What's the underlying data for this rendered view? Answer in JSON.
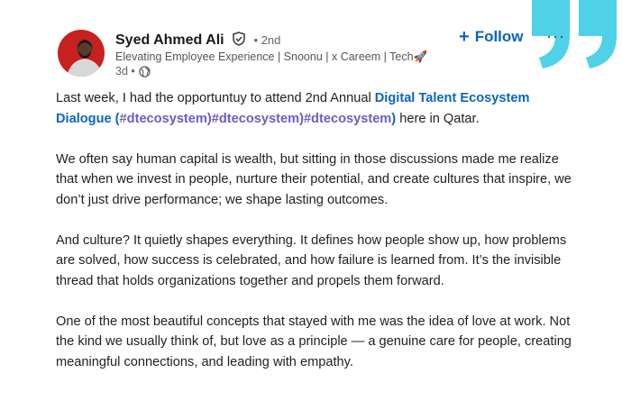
{
  "author": {
    "name": "Syed Ahmed Ali",
    "degree": "• 2nd",
    "headline": "Elevating Employee Experience | Snoonu | x Careem | Tech🚀",
    "time": "3d •"
  },
  "actions": {
    "follow_plus": "+",
    "follow_label": "Follow",
    "more_label": "···"
  },
  "post": {
    "p1_a": "Last week, I had the opportuntuy to attend 2nd Annual ",
    "p1_link": "Digital Talent Ecosystem Dialogue",
    "p1_b": " (",
    "p1_hash1": "#dtecosystem)#dtecosystem)#dtecosystem",
    "p1_c": ") here in Qatar.",
    "p2": "We often say human capital is wealth, but sitting in those discussions made me realize that when we invest in people, nurture their potential, and create cultures that inspire, we don’t just drive performance; we shape lasting outcomes.",
    "p3": "And culture? It quietly shapes everything. It defines how people show up, how problems are solved, how success is celebrated, and how failure is learned from. It’s the invisible thread that holds organizations together and propels them forward.",
    "p4": "One of the most beautiful concepts that stayed with me was the idea of love at work. Not the kind we usually think of, but love as a principle — a genuine care for people, creating meaningful connections, and leading with empathy."
  },
  "colors": {
    "link": "#0a66c2",
    "hashtag": "#6a5ec8",
    "quote_accent": "#4fd1e8"
  },
  "icons": [
    "quote-icon",
    "verified-icon",
    "globe-icon",
    "more-icon"
  ]
}
